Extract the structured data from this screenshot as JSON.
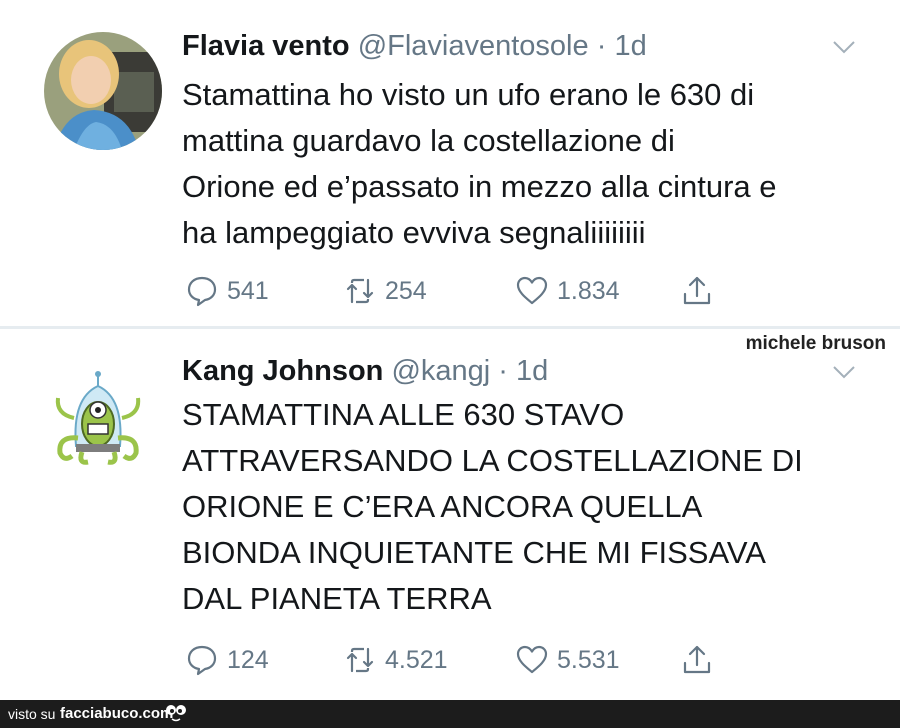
{
  "tweets": [
    {
      "name": "Flavia vento",
      "handle": "@Flaviaventosole",
      "dot": "·",
      "time": "1d",
      "lines": [
        "Stamattina ho visto un ufo erano le 630 di",
        "mattina guardavo la costellazione di",
        "Orione ed e’passato in mezzo alla cintura e",
        "ha lampeggiato evviva segnaliiiiiiii"
      ],
      "replies": "541",
      "retweets": "254",
      "likes": "1.834",
      "avatar_icon": "woman-photo-avatar"
    },
    {
      "name": "Kang Johnson",
      "handle": "@kangj",
      "dot": "·",
      "time": "1d",
      "lines": [
        "STAMATTINA ALLE 630 STAVO",
        "ATTRAVERSANDO LA COSTELLAZIONE DI",
        "ORIONE E C’ERA ANCORA QUELLA",
        "BIONDA INQUIETANTE CHE MI FISSAVA",
        "DAL PIANETA TERRA"
      ],
      "replies": "124",
      "retweets": "4.521",
      "likes": "5.531",
      "avatar_icon": "alien-kang-avatar"
    }
  ],
  "watermark": "michele bruson",
  "footer": {
    "visto_su": "visto su",
    "site": "facciabuco.com"
  },
  "colors": {
    "text": "#14171a",
    "secondary": "#657786",
    "divider": "#e6ecf0",
    "footer_bg": "#1c1c1c"
  }
}
